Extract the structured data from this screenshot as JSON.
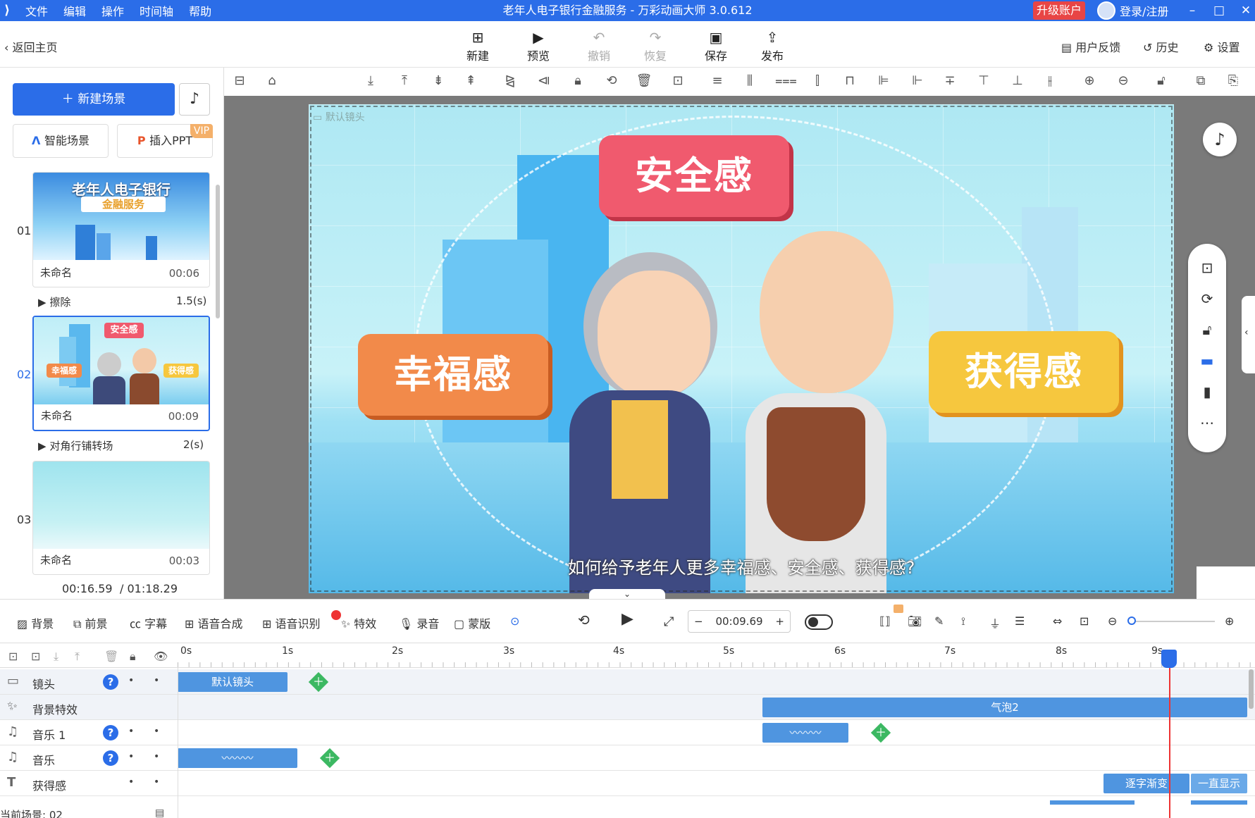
{
  "titlebar": {
    "menu": [
      "文件",
      "编辑",
      "操作",
      "时间轴",
      "帮助"
    ],
    "title": "老年人电子银行金融服务 - 万彩动画大师 3.0.612",
    "upgrade": "升级账户",
    "login": "登录/注册"
  },
  "toolbar": {
    "back": "返回主页",
    "buttons": [
      {
        "label": "新建",
        "icon": "new-icon",
        "enabled": true
      },
      {
        "label": "预览",
        "icon": "preview-icon",
        "enabled": true
      },
      {
        "label": "撤销",
        "icon": "undo-icon",
        "enabled": false
      },
      {
        "label": "恢复",
        "icon": "redo-icon",
        "enabled": false
      },
      {
        "label": "保存",
        "icon": "save-icon",
        "enabled": true
      },
      {
        "label": "发布",
        "icon": "publish-icon",
        "enabled": true
      }
    ],
    "right": {
      "feedback": "用户反馈",
      "history": "历史",
      "settings": "设置"
    }
  },
  "left": {
    "new_scene": "新建场景",
    "smart_scene": "智能场景",
    "insert_ppt": "插入PPT",
    "vip": "VIP",
    "scenes": [
      {
        "num": "01",
        "name": "未命名",
        "time": "00:06",
        "thumb_title": "老年人电子银行",
        "thumb_sub": "金融服务",
        "transition": "擦除",
        "transition_dur": "1.5(s)"
      },
      {
        "num": "02",
        "name": "未命名",
        "time": "00:09",
        "transition": "对角行铺转场",
        "transition_dur": "2(s)",
        "selected": true
      },
      {
        "num": "03",
        "name": "未命名",
        "time": "00:03"
      }
    ],
    "current_time": "00:16.59",
    "total_time": "/ 01:18.29"
  },
  "stage": {
    "camera_label": "默认镜头",
    "bubble_top": "安全感",
    "bubble_left": "幸福感",
    "bubble_right": "获得感",
    "thumb_bubbles": [
      "安全感",
      "幸福感",
      "获得感"
    ],
    "caption": "如何给予老年人更多幸福感、安全感、获得感?"
  },
  "playbar": {
    "items": [
      "背景",
      "前景",
      "字幕",
      "语音合成",
      "语音识别",
      "特效",
      "录音",
      "蒙版"
    ],
    "time": "00:09.69"
  },
  "timeline": {
    "ticks": [
      "0s",
      "1s",
      "2s",
      "3s",
      "4s",
      "5s",
      "6s",
      "7s",
      "8s",
      "9s"
    ],
    "rows": [
      {
        "label": "镜头",
        "clip": "默认镜头"
      },
      {
        "label": "背景特效",
        "clip": "气泡2"
      },
      {
        "label": "音乐 1"
      },
      {
        "label": "音乐"
      },
      {
        "label": "获得感",
        "clip1": "逐字渐变",
        "clip2": "一直显示"
      }
    ],
    "status": "当前场景: 02"
  }
}
